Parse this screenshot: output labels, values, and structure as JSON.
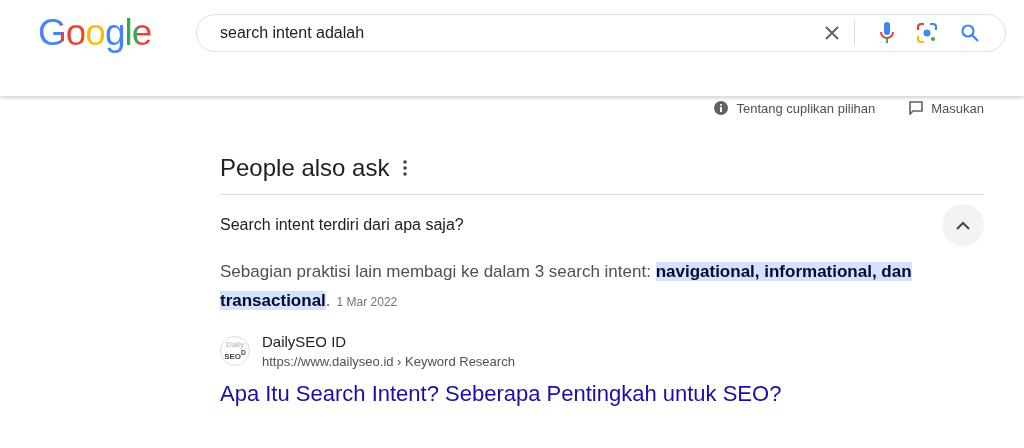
{
  "header": {
    "logo": "Google",
    "search": {
      "value": "search intent adalah"
    }
  },
  "snippet_links": [
    "Tentang cuplikan pilihan",
    "Masukan"
  ],
  "people_also_ask": {
    "title": "People also ask",
    "question": {
      "text": "Search intent terdiri dari apa saja?",
      "expanded": true
    },
    "answer": "Sebagian praktisi lain membagi ke dalam 3 search intent: **navigational, informational, dan transactional**.",
    "date": "1 Mar 2022",
    "source": {
      "favicon_top": "Daily",
      "favicon_bottom": "SEO$^{D}$",
      "site": "DailySEO ID",
      "url": "https://www.dailyseo.id › Keyword Research",
      "title": "Apa Itu Search Intent? Seberapa Pentingkah untuk SEO?"
    }
  }
}
